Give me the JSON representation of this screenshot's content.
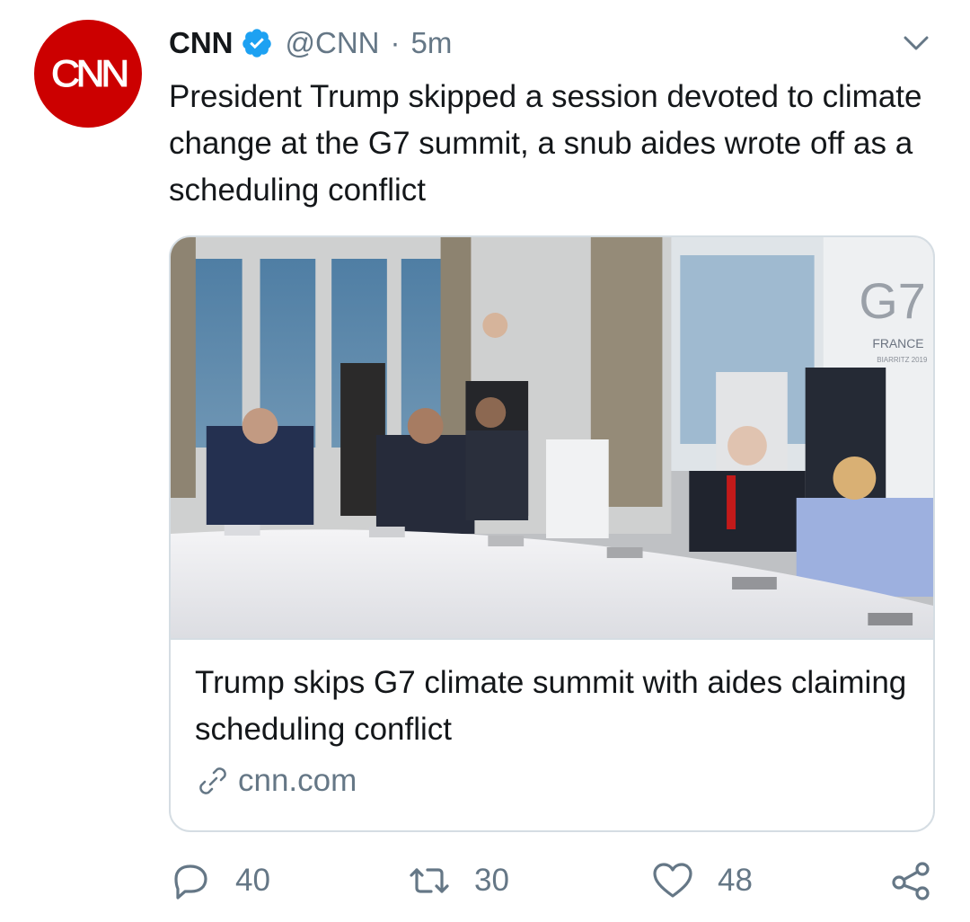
{
  "account": {
    "display_name": "CNN",
    "handle": "@CNN",
    "separator": "·",
    "time": "5m",
    "avatar_logo": "CNN",
    "verified_icon": "verified-badge-icon"
  },
  "tweet": {
    "text": "President Trump skipped a session devoted to climate change at the G7 summit, a snub aides wrote off as a scheduling conflict"
  },
  "card": {
    "image_sign_text": "G7",
    "image_sign_sub": "FRANCE",
    "image_sign_small": "BIARRITZ 2019",
    "title": "Trump skips G7 climate summit with aides claiming scheduling conflict",
    "domain": "cnn.com",
    "link_icon": "link-icon"
  },
  "actions": {
    "reply_count": "40",
    "retweet_count": "30",
    "like_count": "48",
    "reply_icon": "reply-icon",
    "retweet_icon": "retweet-icon",
    "like_icon": "heart-icon",
    "share_icon": "share-icon"
  },
  "colors": {
    "avatar_red": "#cc0000",
    "verified_blue": "#1da1f2",
    "secondary_text": "#657786",
    "border": "#d5dde3"
  }
}
